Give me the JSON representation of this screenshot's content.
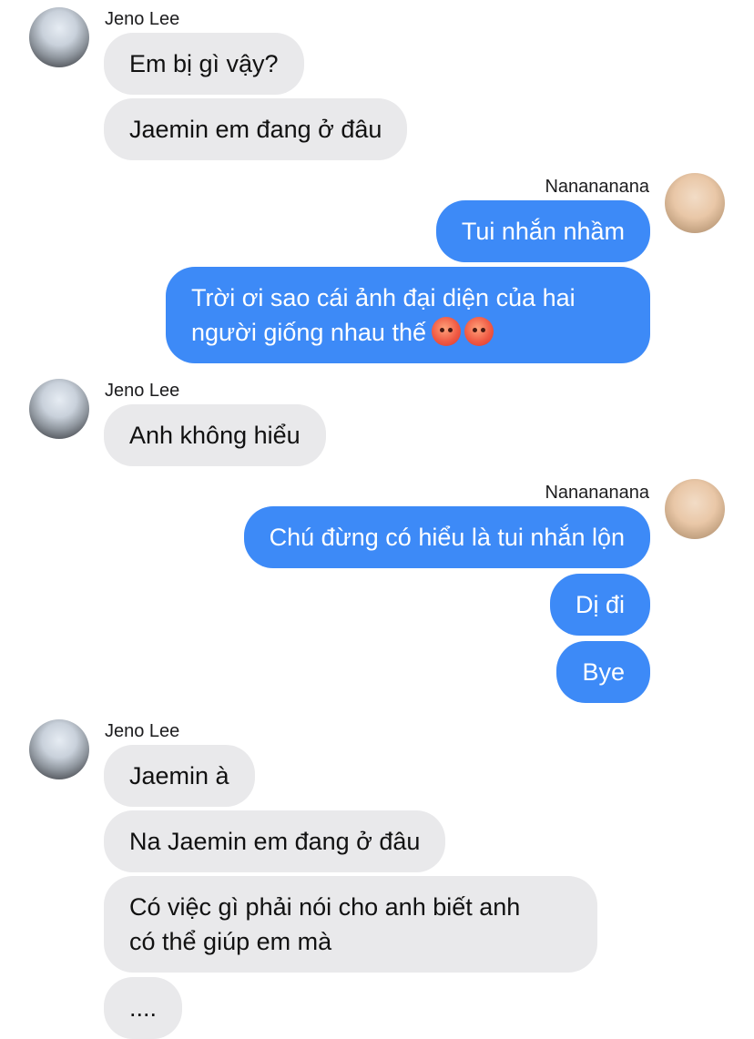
{
  "contacts": {
    "jeno": {
      "name": "Jeno Lee",
      "avatar": "tree-photo-avatar"
    },
    "nana": {
      "name": "Nanananana",
      "avatar": "blond-person-avatar"
    }
  },
  "messages": [
    {
      "sender": "Jeno Lee",
      "text": "Em bị gì vậy?"
    },
    {
      "sender": "Jeno Lee",
      "text": "Jaemin em đang ở đâu"
    },
    {
      "sender": "Nanananana",
      "text": "Tui nhắn nhầm"
    },
    {
      "sender": "Nanananana",
      "text_line1": "Trời ơi sao cái ảnh đại diện của hai",
      "text_line2": "người giống nhau thế",
      "emoji": [
        "angry-face",
        "angry-face"
      ]
    },
    {
      "sender": "Jeno Lee",
      "text": "Anh không hiểu"
    },
    {
      "sender": "Nanananana",
      "text": "Chú đừng có hiểu là tui nhắn lộn"
    },
    {
      "sender": "Nanananana",
      "text": "Dị đi"
    },
    {
      "sender": "Nanananana",
      "text": "Bye"
    },
    {
      "sender": "Jeno Lee",
      "text": "Jaemin à"
    },
    {
      "sender": "Jeno Lee",
      "text": "Na Jaemin em đang ở đâu"
    },
    {
      "sender": "Jeno Lee",
      "text_line1": "Có việc gì phải nói cho anh biết anh",
      "text_line2": "có thể giúp em mà"
    },
    {
      "sender": "Jeno Lee",
      "text": "...."
    }
  ],
  "colors": {
    "incoming_bubble": "#e9e9eb",
    "outgoing_bubble": "#3d8af7",
    "outgoing_text": "#ffffff"
  }
}
